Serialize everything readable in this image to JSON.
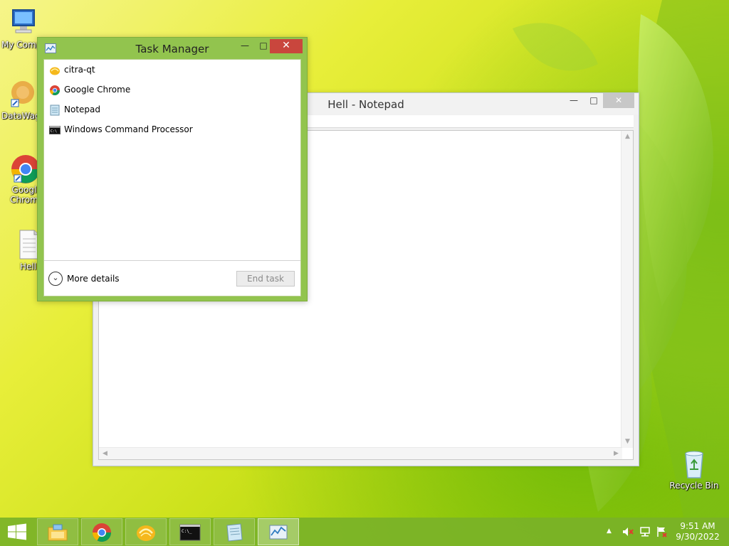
{
  "desktop": {
    "icons": [
      {
        "label": "My Comp",
        "icon": "computer-icon"
      },
      {
        "label": "DataWag",
        "icon": "datawag-icon"
      },
      {
        "label": "Googl Chrom",
        "icon": "chrome-icon"
      },
      {
        "label": "Hell",
        "icon": "text-file-icon"
      },
      {
        "label": "Recycle Bin",
        "icon": "recycle-bin-icon"
      }
    ]
  },
  "notepad": {
    "title": "Hell - Notepad",
    "content": ""
  },
  "task_manager": {
    "title": "Task Manager",
    "processes": [
      {
        "name": "citra-qt",
        "icon": "citra-icon"
      },
      {
        "name": "Google Chrome",
        "icon": "chrome-icon"
      },
      {
        "name": "Notepad",
        "icon": "notepad-icon"
      },
      {
        "name": "Windows Command Processor",
        "icon": "cmd-icon"
      }
    ],
    "more_details_label": "More details",
    "end_task_label": "End task"
  },
  "taskbar": {
    "pinned": [
      {
        "name": "File Explorer",
        "icon": "file-explorer-icon"
      },
      {
        "name": "Google Chrome",
        "icon": "chrome-icon"
      },
      {
        "name": "citra-qt",
        "icon": "citra-icon"
      },
      {
        "name": "Command Prompt",
        "icon": "cmd-icon"
      },
      {
        "name": "Notepad",
        "icon": "notepad-icon"
      },
      {
        "name": "Task Manager",
        "icon": "task-manager-icon"
      }
    ],
    "clock": {
      "time": "9:51 AM",
      "date": "9/30/2022"
    }
  },
  "colors": {
    "taskmgr_frame": "#92c44e",
    "close_red": "#c9463d",
    "taskbar": "#7ab228"
  }
}
